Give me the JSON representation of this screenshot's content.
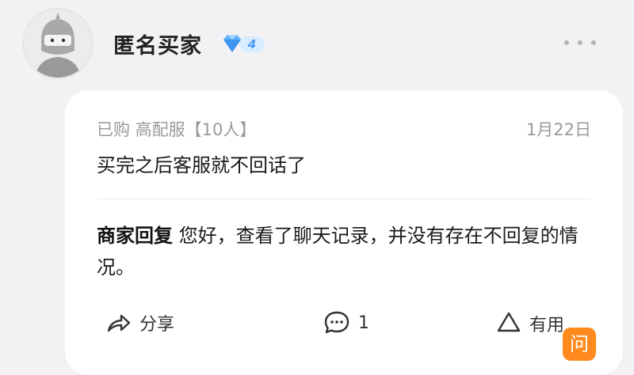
{
  "header": {
    "username": "匿名买家",
    "vip_level": "4",
    "avatar_icon": "ninja-avatar-icon",
    "more_icon": "more-dots-icon"
  },
  "review": {
    "meta": "已购 高配服【10人】",
    "date": "1月22日",
    "text": "买完之后客服就不回话了"
  },
  "reply": {
    "label": "商家回复",
    "text": " 您好，查看了聊天记录，并没有存在不回复的情况。"
  },
  "actions": {
    "share_label": "分享",
    "comment_count": "1",
    "useful_label": "有用"
  },
  "float_button": {
    "label": "问"
  },
  "colors": {
    "background": "#f2f2f4",
    "card": "#ffffff",
    "muted_text": "#9a9a9a",
    "vip_blue": "#4a9af5",
    "ask_orange": "#ff8a1e"
  }
}
